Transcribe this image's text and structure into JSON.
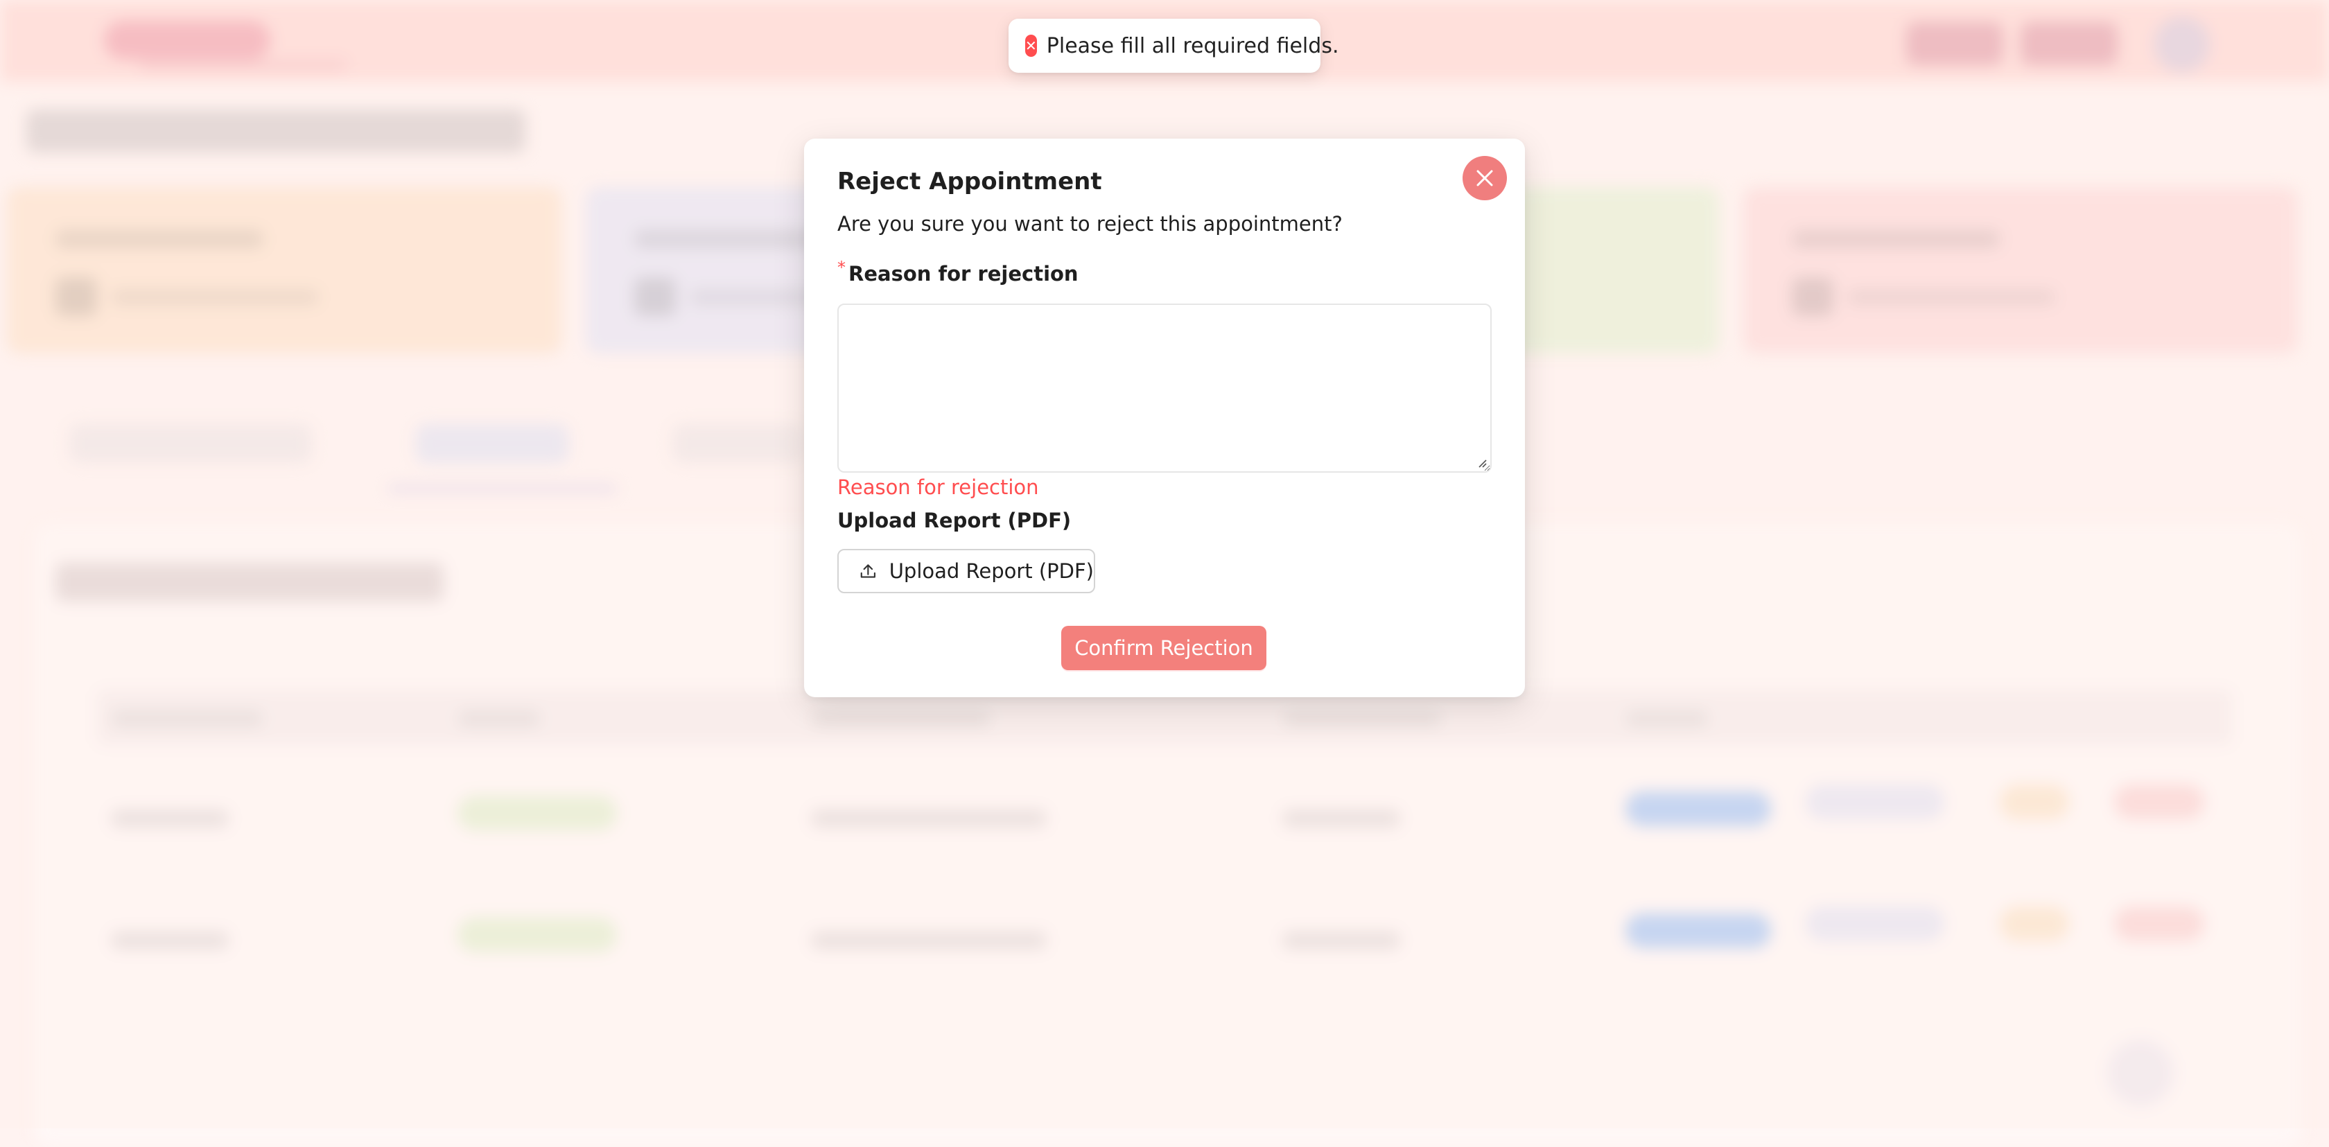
{
  "toast": {
    "icon": "error-circle-icon",
    "message": "Please fill all required fields."
  },
  "modal": {
    "title": "Reject Appointment",
    "description": "Are you sure you want to reject this appointment?",
    "close_icon": "close-icon",
    "reason_field": {
      "required_marker": "*",
      "label": "Reason for rejection",
      "value": "",
      "error": "Reason for rejection"
    },
    "upload": {
      "label": "Upload Report (PDF)",
      "button_label": "Upload Report (PDF)",
      "icon": "upload-icon"
    },
    "confirm_label": "Confirm Rejection"
  },
  "colors": {
    "error": "#ff4d4f",
    "confirm_button": "#f3807c",
    "close_button": "#f07e7e",
    "topbar": "#ffd7d3"
  }
}
